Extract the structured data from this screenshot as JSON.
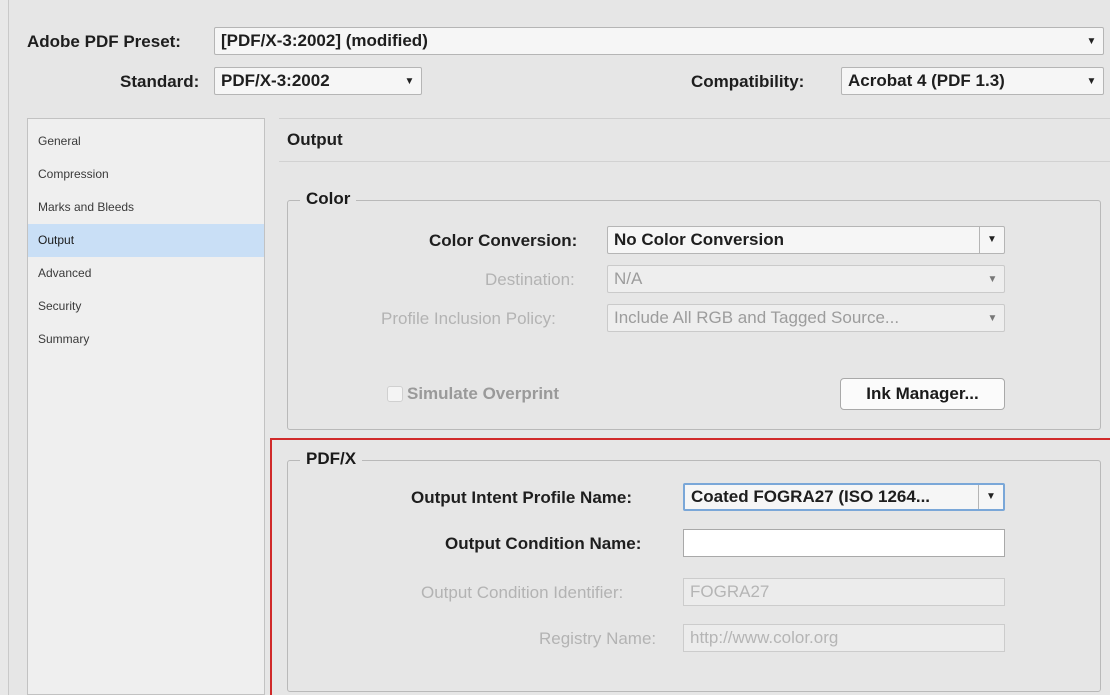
{
  "header": {
    "preset_label": "Adobe PDF Preset:",
    "preset_value": "[PDF/X-3:2002] (modified)",
    "standard_label": "Standard:",
    "standard_value": "PDF/X-3:2002",
    "compatibility_label": "Compatibility:",
    "compatibility_value": "Acrobat 4 (PDF 1.3)"
  },
  "sidebar": {
    "items": [
      {
        "label": "General"
      },
      {
        "label": "Compression"
      },
      {
        "label": "Marks and Bleeds"
      },
      {
        "label": "Output"
      },
      {
        "label": "Advanced"
      },
      {
        "label": "Security"
      },
      {
        "label": "Summary"
      }
    ],
    "selected": "Output"
  },
  "panel": {
    "title": "Output",
    "color_group": {
      "legend": "Color",
      "conversion_label": "Color Conversion:",
      "conversion_value": "No Color Conversion",
      "destination_label": "Destination:",
      "destination_value": "N/A",
      "profile_label": "Profile Inclusion Policy:",
      "profile_value": "Include All RGB and Tagged Source...",
      "simulate_label": "Simulate Overprint",
      "ink_button": "Ink Manager..."
    },
    "pdfx_group": {
      "legend": "PDF/X",
      "intent_label": "Output Intent Profile Name:",
      "intent_value": "Coated FOGRA27 (ISO 1264...",
      "condition_label": "Output Condition Name:",
      "condition_value": "",
      "identifier_label": "Output Condition Identifier:",
      "identifier_value": "FOGRA27",
      "registry_label": "Registry Name:",
      "registry_value": "http://www.color.org"
    }
  },
  "colors": {
    "selection": "#c9dff6",
    "highlight_border": "#d02a2a",
    "focus_border": "#7aa7d8"
  }
}
